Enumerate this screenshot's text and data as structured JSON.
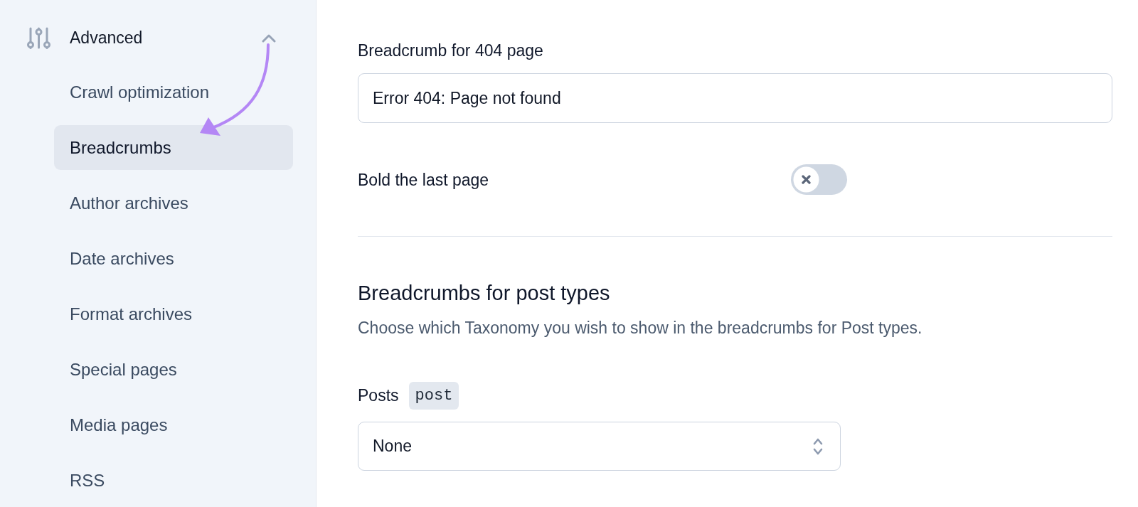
{
  "sidebar": {
    "section": {
      "label": "Advanced",
      "expanded": true
    },
    "items": [
      {
        "label": "Crawl optimization",
        "selected": false
      },
      {
        "label": "Breadcrumbs",
        "selected": true
      },
      {
        "label": "Author archives",
        "selected": false
      },
      {
        "label": "Date archives",
        "selected": false
      },
      {
        "label": "Format archives",
        "selected": false
      },
      {
        "label": "Special pages",
        "selected": false
      },
      {
        "label": "Media pages",
        "selected": false
      },
      {
        "label": "RSS",
        "selected": false
      }
    ]
  },
  "breadcrumb_404": {
    "label": "Breadcrumb for 404 page",
    "value": "Error 404: Page not found"
  },
  "bold_last_page": {
    "label": "Bold the last page",
    "on": false
  },
  "post_types": {
    "heading": "Breadcrumbs for post types",
    "description": "Choose which Taxonomy you wish to show in the breadcrumbs for Post types.",
    "posts": {
      "label": "Posts",
      "badge": "post",
      "value": "None"
    }
  }
}
